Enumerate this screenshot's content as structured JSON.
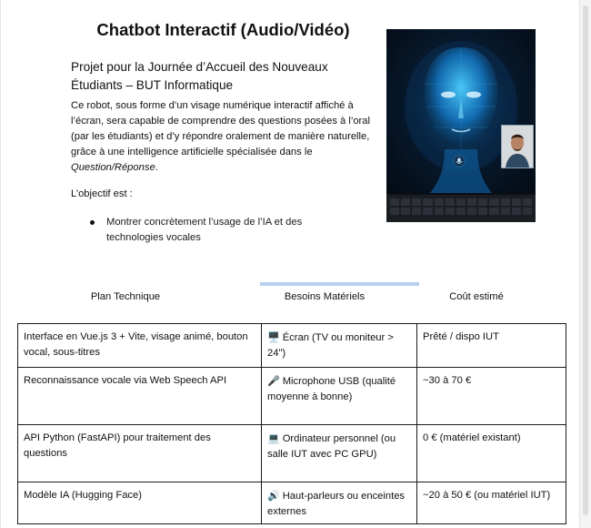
{
  "title": "Chatbot Interactif (Audio/Vidéo)",
  "subtitle": "Projet pour la Journée d’Accueil des Nouveaux Étudiants – BUT Informatique",
  "description": {
    "text": "Ce robot, sous forme d’un visage numérique interactif affiché à l’écran, sera capable de comprendre des questions posées à l’oral (par les étudiants) et d’y répondre oralement de manière naturelle, grâce à une intelligence artificielle spécialisée dans le ",
    "emphasis": "Question/Réponse",
    "end": "."
  },
  "objective_label": "L’objectif est :",
  "bullets": [
    "Montrer concrètement l’usage de l’IA et des technologies vocales"
  ],
  "table": {
    "headers": [
      "Plan Technique",
      "Besoins Matériels",
      "Coût estimé"
    ],
    "rows": [
      {
        "plan": "Interface en Vue.js 3 + Vite, visage animé, bouton vocal, sous-titres",
        "icon": "🖥️",
        "icon_name": "desktop-computer-icon",
        "material": "Écran (TV ou moniteur > 24\")",
        "cost": "Prêté / dispo IUT"
      },
      {
        "plan": "Reconnaissance vocale via Web Speech API",
        "icon": "🎤",
        "icon_name": "microphone-icon",
        "material": "Microphone USB (qualité moyenne à bonne)",
        "cost": "~30 à 70 €"
      },
      {
        "plan": "API Python (FastAPI) pour traitement des questions",
        "icon": "💻",
        "icon_name": "laptop-icon",
        "material": "Ordinateur personnel (ou salle IUT avec PC GPU)",
        "cost": "0 € (matériel existant)"
      },
      {
        "plan": "Modèle IA (Hugging Face)",
        "icon": "🔊",
        "icon_name": "speaker-icon",
        "material": "Haut-parleurs ou enceintes externes",
        "cost": "~20 à 50 € (ou matériel IUT)"
      }
    ]
  },
  "colors": {
    "text": "#111111",
    "tab_indicator": "#b7d0ef",
    "screen_glow": "#1da8f0"
  }
}
